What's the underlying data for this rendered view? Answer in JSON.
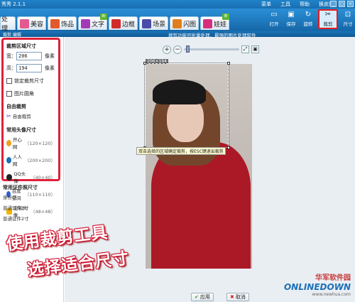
{
  "window": {
    "title": "秀秀 2.1.1",
    "menu": [
      "菜单",
      "工具",
      "帮助",
      "换皮肤"
    ],
    "controls": [
      "_",
      "□",
      "×"
    ]
  },
  "tabs": [
    {
      "label": "处理",
      "new": false,
      "color": "#3b86c9"
    },
    {
      "label": "美容",
      "new": false,
      "color": "#e25a8e"
    },
    {
      "label": "饰品",
      "new": false,
      "color": "#e15a29"
    },
    {
      "label": "文字",
      "new": true,
      "color": "#a23ab8"
    },
    {
      "label": "边框",
      "new": false,
      "color": "#d22b2b"
    },
    {
      "label": "场景",
      "new": false,
      "color": "#4b4ba8"
    },
    {
      "label": "闪图",
      "new": false,
      "color": "#e07f1d"
    },
    {
      "label": "娃娃",
      "new": true,
      "color": "#d62e7c"
    }
  ],
  "new_badge": "新",
  "toolbar_buttons": [
    {
      "label": "打开",
      "icon": "folder-icon",
      "glyph": "▭"
    },
    {
      "label": "保存",
      "icon": "save-icon",
      "glyph": "▣"
    },
    {
      "label": "旋转",
      "icon": "rotate-icon",
      "glyph": "↻"
    },
    {
      "label": "裁剪",
      "icon": "scissors-icon",
      "glyph": "✂",
      "active": true
    },
    {
      "label": "尺寸",
      "icon": "resize-icon",
      "glyph": "⊡"
    }
  ],
  "subbar": {
    "crumb": "裁剪 编辑",
    "notice": "裁剪功能可批量处理，最强的图片处理软件"
  },
  "crop_panel": {
    "title": "裁剪区域尺寸",
    "width_label": "宽：",
    "width_value": "206",
    "height_label": "高：",
    "height_value": "194",
    "unit": "像素",
    "lock_label": "锁定裁剪尺寸",
    "round_label": "图片圆角",
    "free_title": "自由裁剪",
    "free_item": "自由裁剪",
    "avatar_title": "常用头像尺寸",
    "presets": [
      {
        "name": "开心网",
        "size": "（120×120）",
        "color": "#f0a020"
      },
      {
        "name": "人人网",
        "size": "（200×200）",
        "color": "#1d6fb8"
      },
      {
        "name": "QQ头像",
        "size": "（40×40）",
        "color": "#222222"
      },
      {
        "name": "百度空间",
        "size": "（110×110）",
        "color": "#3060d0"
      },
      {
        "name": "论坛头像",
        "size": "（48×48）",
        "color": "#f2b400"
      }
    ]
  },
  "idcard_panel": {
    "title": "常用证件照尺寸",
    "items": [
      "身份证",
      "普通证件1寸",
      "普通证件2寸"
    ]
  },
  "editor": {
    "size_label": "206×194",
    "tooltip": "双击选择的区域确定裁剪，按ESC键退出裁剪",
    "zoom_in": "+",
    "zoom_out": "−",
    "apply_label": "应用",
    "cancel_label": "取消"
  },
  "caption": {
    "line1": "使用裁剪工具",
    "line2": "选择适合尺寸"
  },
  "watermark": {
    "cn": "华军软件园",
    "en": "ONLINEDOWN",
    "url": "www.newhua.com"
  }
}
